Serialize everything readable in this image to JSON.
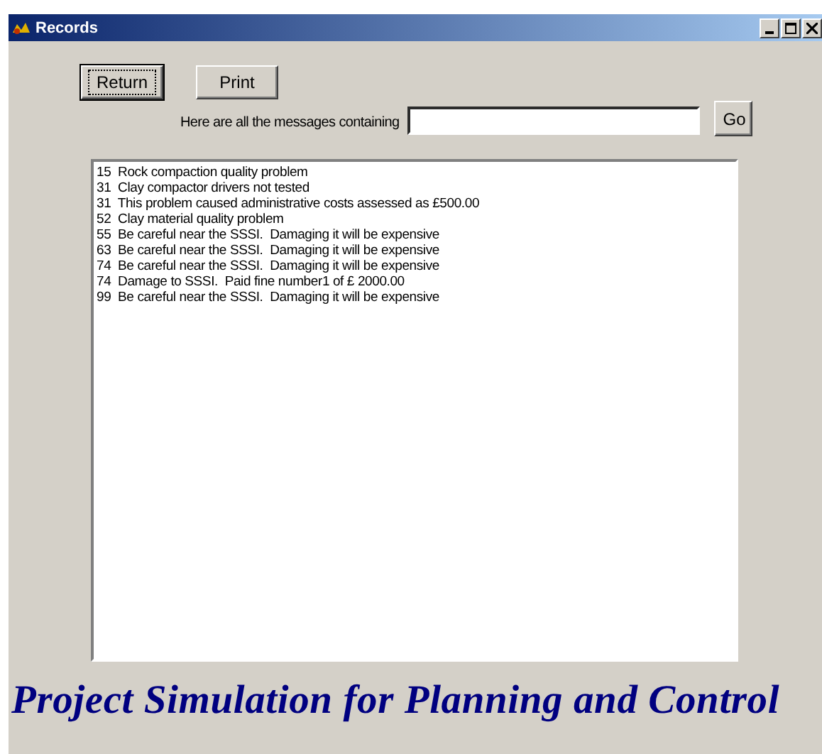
{
  "window": {
    "title": "Records"
  },
  "buttons": [
    {
      "label": "Return",
      "focused": true
    },
    {
      "label": "Print",
      "focused": false
    }
  ],
  "search": {
    "label": "Here are all the messages containing",
    "button": "Go"
  },
  "messages": [
    "15  Rock compaction quality problem",
    "31  Clay compactor drivers not tested",
    "31  This problem caused administrative costs assessed as £500.00",
    "52  Clay material quality problem",
    "55  Be careful near the SSSI.  Damaging it will be expensive",
    "63  Be careful near the SSSI.  Damaging it will be expensive",
    "74  Be careful near the SSSI.  Damaging it will be expensive",
    "74  Damage to SSSI.  Paid fine number1 of £ 2000.00",
    "99  Be careful near the SSSI.  Damaging it will be expensive"
  ],
  "banner": "Project Simulation for Planning and Control"
}
